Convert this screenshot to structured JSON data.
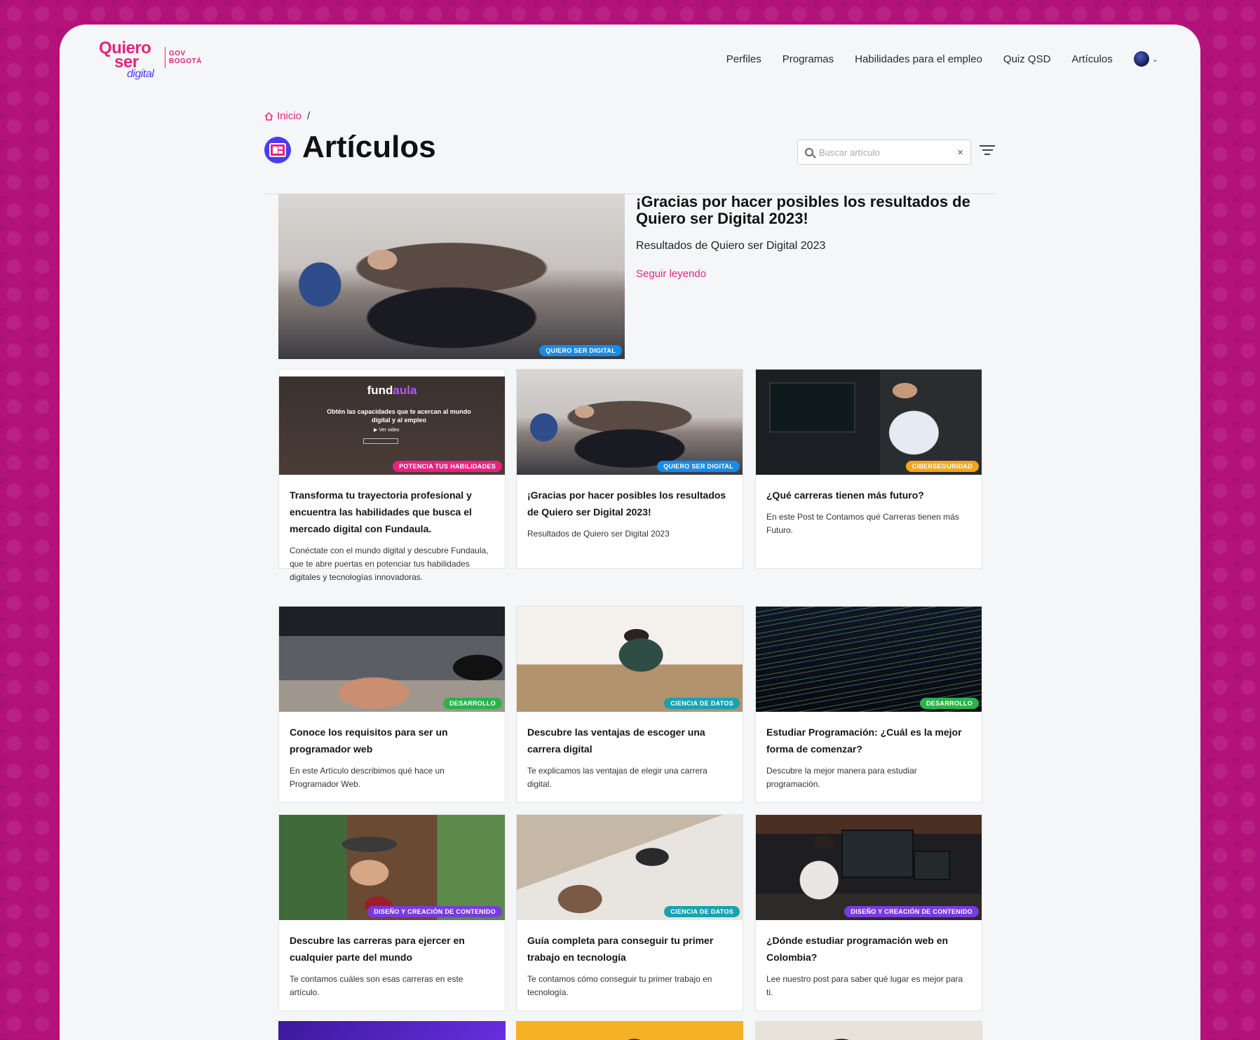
{
  "header": {
    "logo": {
      "line1": "Quiero",
      "line2": "ser",
      "line3": "digital",
      "partner": "GOV\nBOGOTÁ"
    },
    "nav": [
      "Perfiles",
      "Programas",
      "Habilidades para el empleo",
      "Quiz QSD",
      "Artículos"
    ]
  },
  "breadcrumb": {
    "home": "Inicio",
    "separator": "/"
  },
  "page": {
    "title": "Artículos"
  },
  "search": {
    "placeholder": "Buscar artículo",
    "clear": "×"
  },
  "featured": {
    "title": "¡Gracias por hacer posibles los resultados de Quiero ser Digital 2023!",
    "subtitle": "Resultados de Quiero ser Digital 2023",
    "read_more": "Seguir leyendo",
    "tag": "QUIERO SER DIGITAL",
    "tag_color": "#1a8ae6"
  },
  "fundaula_banner": {
    "brand_a": "fund",
    "brand_b": "aula",
    "headline": "Obtén las capacidades que te acercan al mundo digital y al empleo",
    "video": "Ver video"
  },
  "articles": [
    {
      "title": "Transforma tu trayectoria profesional y encuentra las habilidades que busca el mercado digital con Fundaula.",
      "desc": "Conéctate con el mundo digital y descubre Fundaula, que te abre puertas en potenciar tus habilidades digitales y tecnologías innovadoras.",
      "tag": "POTENCIA TUS HABILIDADES",
      "tag_color": "#e6237e"
    },
    {
      "title": "¡Gracias por hacer posibles los resultados de Quiero ser Digital 2023!",
      "desc": "Resultados de Quiero ser Digital 2023",
      "tag": "QUIERO SER DIGITAL",
      "tag_color": "#1a8ae6"
    },
    {
      "title": "¿Qué carreras tienen más futuro?",
      "desc": "En este Post te Contamos qué Carreras tienen más Futuro.",
      "tag": "CIBERSEGURIDAD",
      "tag_color": "#f4a51c"
    },
    {
      "title": "Conoce los requisitos para ser un programador web",
      "desc": "En este Artículo describimos qué hace un Programador Web.",
      "tag": "DESARROLLO",
      "tag_color": "#2cb24a"
    },
    {
      "title": "Descubre las ventajas de escoger una carrera digital",
      "desc": "Te explicamos las ventajas de elegir una carrera digital.",
      "tag": "CIENCIA DE DATOS",
      "tag_color": "#17a3b0"
    },
    {
      "title": "Estudiar Programación: ¿Cuál es la mejor forma de comenzar?",
      "desc": "Descubre la mejor manera para estudiar programación.",
      "tag": "DESARROLLO",
      "tag_color": "#2cb24a"
    },
    {
      "title": "Descubre las carreras para ejercer en cualquier parte del mundo",
      "desc": "Te contamos cuáles son esas carreras en este artículo.",
      "tag": "DISEÑO Y CREACIÓN DE CONTENIDO",
      "tag_color": "#7a3ae0"
    },
    {
      "title": "Guía completa para conseguir tu primer trabajo en tecnología",
      "desc": "Te contamos cómo conseguir tu primer trabajo en tecnología.",
      "tag": "CIENCIA DE DATOS",
      "tag_color": "#17a3b0"
    },
    {
      "title": "¿Dónde estudiar programación web en Colombia?",
      "desc": "Lee nuestro post para saber qué lugar es mejor para ti.",
      "tag": "DISEÑO Y CREACIÓN DE CONTENIDO",
      "tag_color": "#7a3ae0"
    }
  ]
}
